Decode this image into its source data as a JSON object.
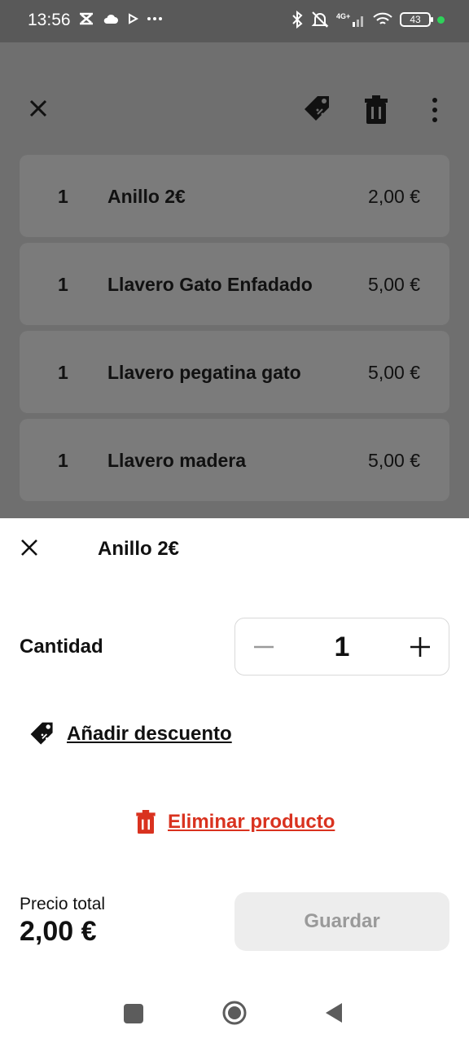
{
  "status_bar": {
    "time": "13:56",
    "battery": "43",
    "icons_left": [
      "app-icon",
      "cloud-icon",
      "play-icon",
      "more-dots-icon"
    ],
    "icons_right": [
      "bluetooth-icon",
      "mute-icon",
      "signal-4g-icon",
      "wifi-icon",
      "battery-icon",
      "active-dot-icon"
    ]
  },
  "toolbar": {
    "icons": [
      "close-icon",
      "discount-tag-icon",
      "trash-icon",
      "more-vertical-icon"
    ]
  },
  "rows": [
    {
      "qty": "1",
      "name": "Anillo 2€",
      "price": "2,00 €"
    },
    {
      "qty": "1",
      "name": "Llavero Gato Enfadado",
      "price": "5,00 €"
    },
    {
      "qty": "1",
      "name": "Llavero pegatina gato",
      "price": "5,00 €"
    },
    {
      "qty": "1",
      "name": "Llavero madera",
      "price": "5,00 €"
    }
  ],
  "sheet": {
    "title": "Anillo 2€",
    "quantity_label": "Cantidad",
    "quantity_value": "1",
    "discount_label": "Añadir descuento",
    "remove_label": "Eliminar producto",
    "total_label": "Precio total",
    "total_value": "2,00 €",
    "save_label": "Guardar"
  },
  "colors": {
    "danger": "#d9321f",
    "scrim": "#6f6f6f",
    "disabled_button": "#ededed"
  }
}
